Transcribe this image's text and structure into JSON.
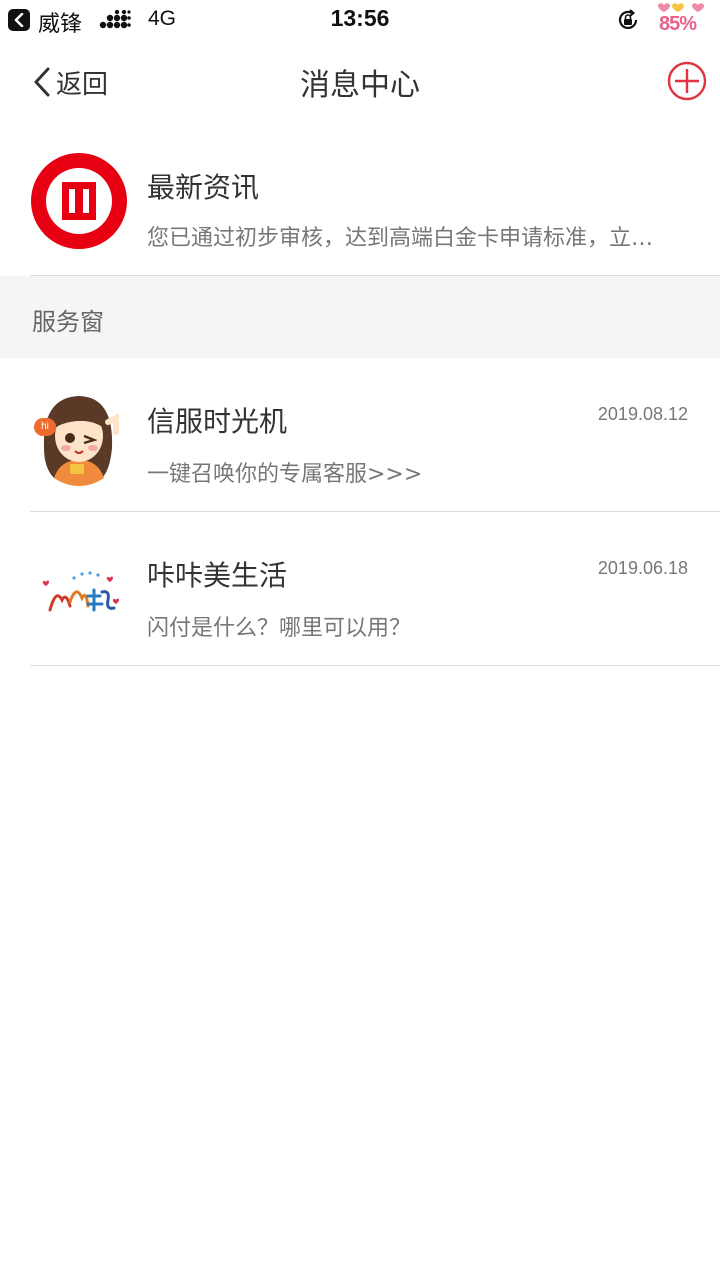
{
  "status_bar": {
    "carrier": "威锋",
    "network": "4G",
    "time": "13:56",
    "battery": "85%"
  },
  "nav": {
    "back_label": "返回",
    "title": "消息中心"
  },
  "top_message": {
    "title": "最新资讯",
    "preview": "您已通过初步审核，达到高端白金卡申请标准，立…",
    "logo_color": "#e60012"
  },
  "section": {
    "label": "服务窗"
  },
  "services": [
    {
      "title": "信服时光机",
      "preview": "一键召唤你的专属客服>>>",
      "date": "2019.08.12",
      "avatar_badge": "hi"
    },
    {
      "title": "咔咔美生活",
      "preview": "闪付是什么？哪里可以用？",
      "date": "2019.06.18"
    }
  ],
  "colors": {
    "accent": "#e60012",
    "section_bg": "#f5f5f5"
  }
}
